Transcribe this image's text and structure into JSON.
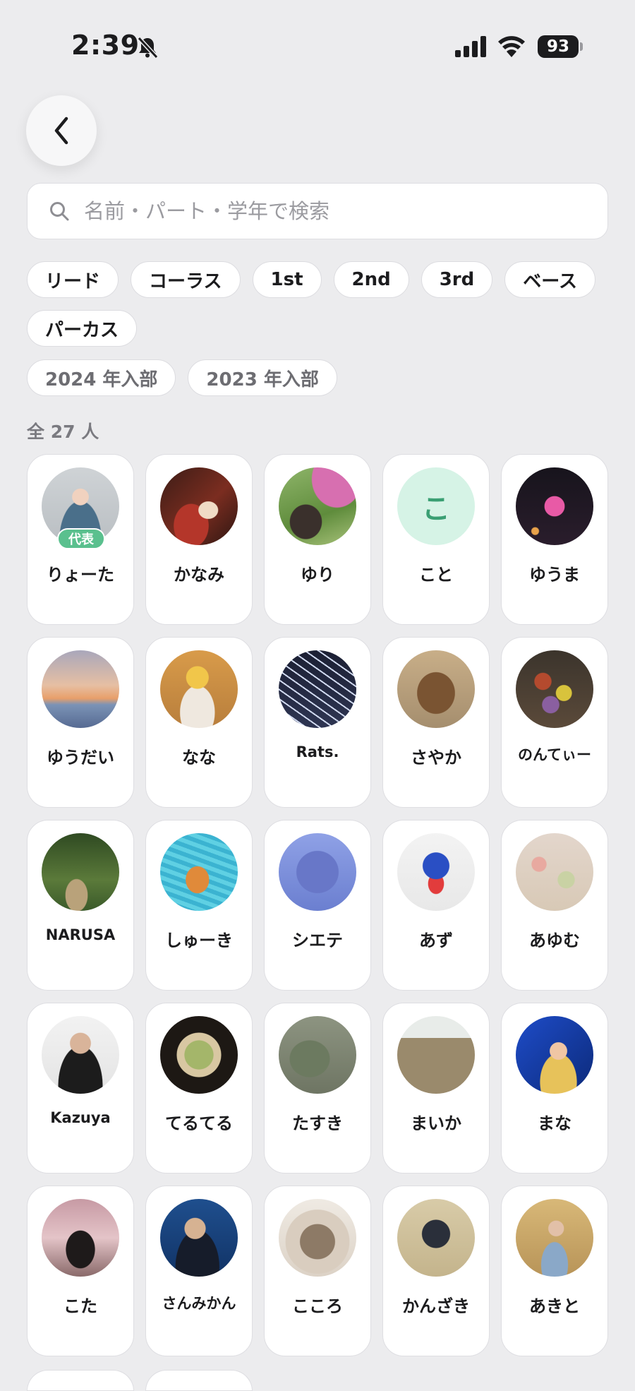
{
  "status_bar": {
    "time": "2:39",
    "battery": "93"
  },
  "search": {
    "placeholder": "名前・パート・学年で検索"
  },
  "filters": {
    "parts": [
      "リード",
      "コーラス",
      "1st",
      "2nd",
      "3rd",
      "ベース",
      "パーカス"
    ],
    "years": [
      "2024 年入部",
      "2023 年入部"
    ]
  },
  "member_count": "全 27 人",
  "members": [
    {
      "name": "りょーた",
      "badge": "代表",
      "photo": "ptd"
    },
    {
      "name": "かなみ",
      "photo": "stage"
    },
    {
      "name": "ゆり",
      "photo": "garden"
    },
    {
      "name": "こと",
      "initial": "こ"
    },
    {
      "name": "ゆうま",
      "photo": "night"
    },
    {
      "name": "ゆうだい",
      "photo": "sunset"
    },
    {
      "name": "なな",
      "photo": "singer"
    },
    {
      "name": "Rats.",
      "photo": "torii"
    },
    {
      "name": "さやか",
      "photo": "capybara"
    },
    {
      "name": "のんてぃー",
      "photo": "bouquet"
    },
    {
      "name": "NARUSA",
      "photo": "forest"
    },
    {
      "name": "しゅーき",
      "photo": "pool"
    },
    {
      "name": "シエテ",
      "photo": "bear"
    },
    {
      "name": "あず",
      "photo": "mascot"
    },
    {
      "name": "あゆむ",
      "photo": "floral"
    },
    {
      "name": "Kazuya",
      "photo": "capman"
    },
    {
      "name": "てるてる",
      "photo": "ramen"
    },
    {
      "name": "たすき",
      "photo": "grey"
    },
    {
      "name": "まいか",
      "photo": "building"
    },
    {
      "name": "まな",
      "photo": "bluestage"
    },
    {
      "name": "こた",
      "photo": "cherry"
    },
    {
      "name": "さんみかん",
      "photo": "mic"
    },
    {
      "name": "こころ",
      "photo": "dog"
    },
    {
      "name": "かんざき",
      "photo": "mirror"
    },
    {
      "name": "あきと",
      "photo": "hall"
    }
  ]
}
